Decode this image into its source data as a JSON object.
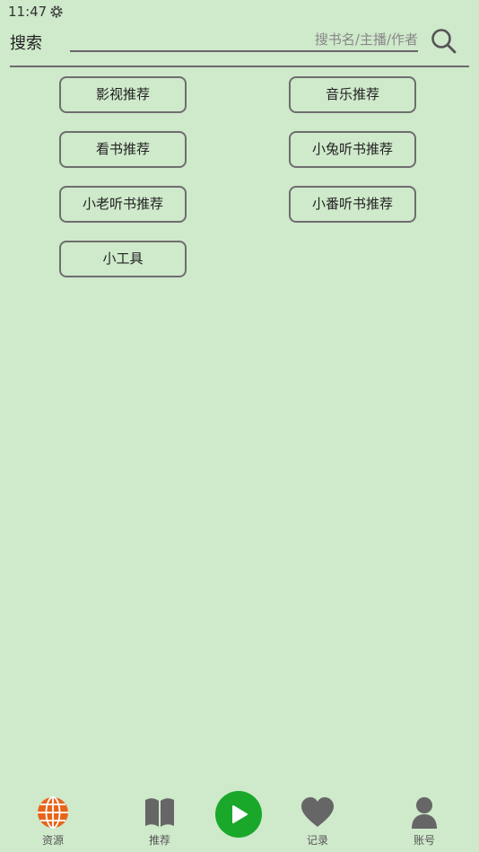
{
  "status": {
    "time": "11:47"
  },
  "search": {
    "label": "搜索",
    "placeholder": "搜书名/主播/作者",
    "value": ""
  },
  "buttons": [
    {
      "id": "video-recommend",
      "label": "影视推荐"
    },
    {
      "id": "music-recommend",
      "label": "音乐推荐"
    },
    {
      "id": "read-recommend",
      "label": "看书推荐"
    },
    {
      "id": "xiaotu-audiobook",
      "label": "小兔听书推荐"
    },
    {
      "id": "xiaolao-audiobook",
      "label": "小老听书推荐"
    },
    {
      "id": "xiaofan-audiobook",
      "label": "小番听书推荐"
    },
    {
      "id": "tools",
      "label": "小工具"
    }
  ],
  "bottom_nav": {
    "tabs": [
      {
        "label": "资源",
        "icon": "globe-icon",
        "color": "#e8641a"
      },
      {
        "label": "推荐",
        "icon": "book-icon",
        "color": "#666666"
      },
      {
        "label": "记录",
        "icon": "heart-icon",
        "color": "#666666"
      },
      {
        "label": "账号",
        "icon": "user-icon",
        "color": "#666666"
      }
    ],
    "play": {
      "icon": "play-icon",
      "color": "#1aa82a"
    }
  },
  "colors": {
    "background": "#cfe9cb",
    "active": "#e8641a",
    "accent": "#1aa82a"
  }
}
